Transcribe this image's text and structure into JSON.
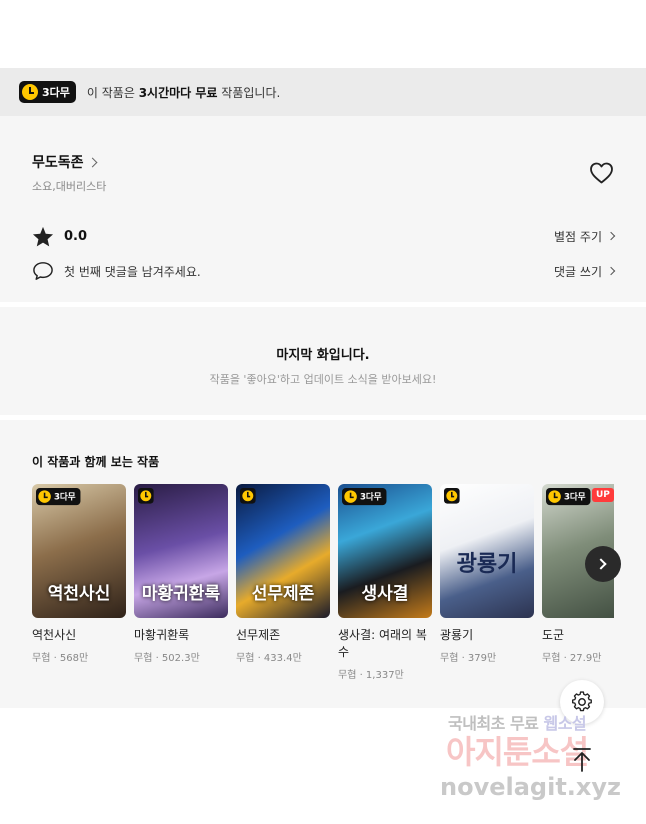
{
  "notice": {
    "badge": "3다무",
    "prefix": "이 작품은 ",
    "emphasis": "3시간마다 무료",
    "suffix": " 작품입니다."
  },
  "work": {
    "title": "무도독존",
    "authors": "소요,대버리스타",
    "rating": "0.0",
    "rate_link": "별점 주기",
    "comment_prompt": "첫 번째 댓글을 남겨주세요.",
    "comment_link": "댓글 쓰기"
  },
  "last_episode": {
    "heading": "마지막 화입니다.",
    "sub": "작품을 '좋아요'하고 업데이트 소식을 받아보세요!"
  },
  "recommend": {
    "title": "이 작품과 함께 보는 작품",
    "items": [
      {
        "name": "역천사신",
        "cover_text": "역천사신",
        "meta": "무협 · 568만",
        "badge": "3다무",
        "up": ""
      },
      {
        "name": "마황귀환록",
        "cover_text": "마황귀환록",
        "meta": "무협 · 502.3만",
        "badge": "",
        "up": ""
      },
      {
        "name": "선무제존",
        "cover_text": "선무제존",
        "meta": "무협 · 433.4만",
        "badge": "",
        "up": ""
      },
      {
        "name": "생사결: 여래의 복수",
        "cover_text": "생사결",
        "meta": "무협 · 1,337만",
        "badge": "3다무",
        "up": ""
      },
      {
        "name": "광룡기",
        "cover_text": "광룡기",
        "meta": "무협 · 379만",
        "badge": "",
        "up": ""
      },
      {
        "name": "도군",
        "cover_text": "",
        "meta": "무협 · 27.9만",
        "badge": "3다무",
        "up": "UP"
      }
    ]
  },
  "icons": {
    "heart": "heart-icon",
    "star": "star-icon",
    "comment": "comment-icon",
    "settings": "gear-icon",
    "scroll_top": "arrow-up-icon",
    "next": "chevron-right-icon"
  },
  "watermark": {
    "line1_a": "국내최초 무료 ",
    "line1_b": "웹소설",
    "line2": "아지툰소설",
    "line3": "novelagit.xyz"
  }
}
